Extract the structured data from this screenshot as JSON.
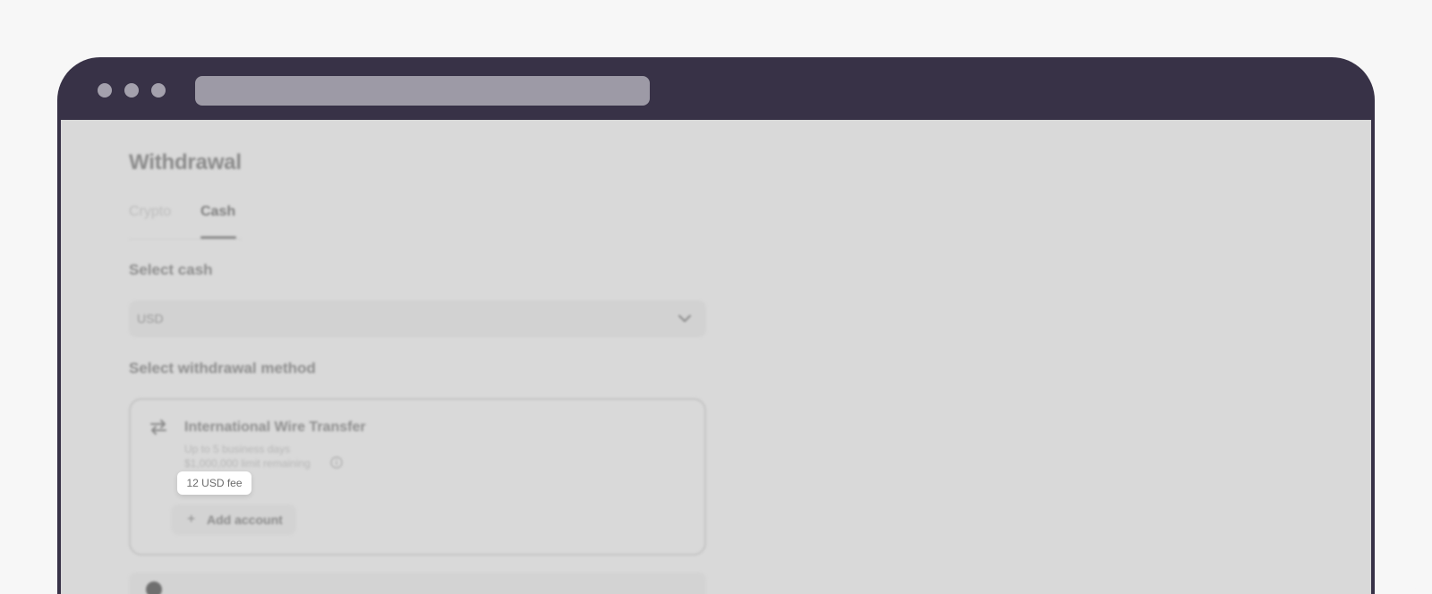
{
  "page": {
    "title": "Withdrawal",
    "tabs": [
      "Crypto",
      "Cash"
    ],
    "active_tab": "Cash"
  },
  "select_cash": {
    "label": "Select cash",
    "value": "USD",
    "icon": "chevron-down-icon"
  },
  "withdrawal_method": {
    "label": "Select withdrawal method",
    "method": {
      "icon": "transfer-arrows-icon",
      "name": "International Wire Transfer",
      "timing": "Up to 5 business days",
      "limit": "$1,000,000 limit remaining",
      "info_icon": "info-icon",
      "fee": "12 USD fee"
    },
    "add_account_label": "Add account",
    "add_icon": "plus-icon"
  },
  "notice": {
    "icon": "info-circle-icon",
    "text": ""
  },
  "colors": {
    "browser_chrome": "#383247",
    "overlay": "#d9d9d9",
    "tooltip_bg": "#ffffff"
  }
}
